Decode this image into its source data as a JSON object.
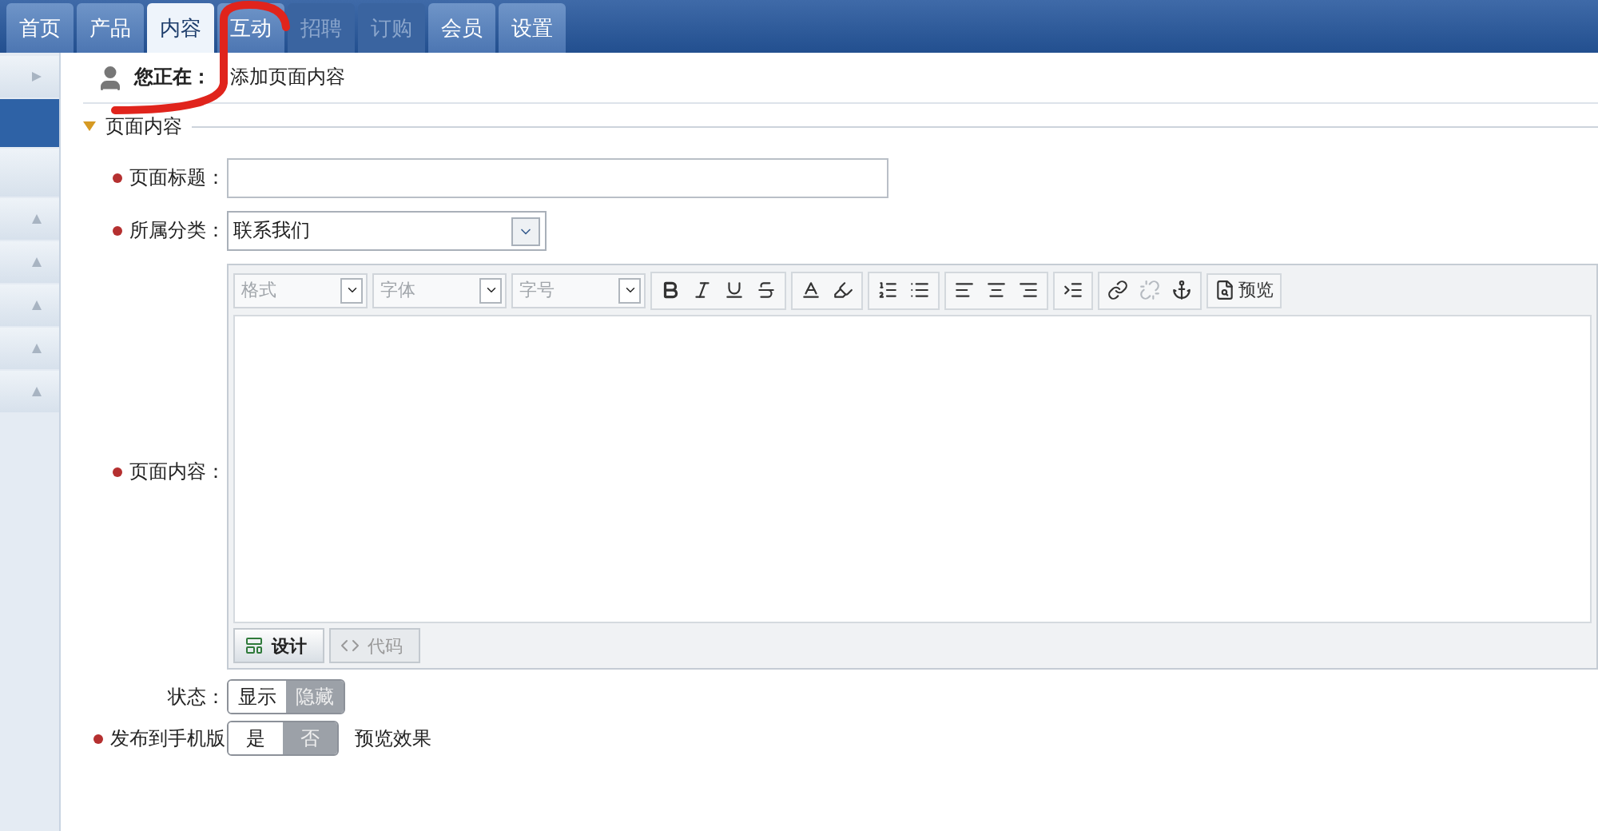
{
  "nav": {
    "tabs": [
      {
        "label": "首页",
        "selected": false,
        "disabled": false
      },
      {
        "label": "产品",
        "selected": false,
        "disabled": false
      },
      {
        "label": "内容",
        "selected": true,
        "disabled": false
      },
      {
        "label": "互动",
        "selected": false,
        "disabled": false
      },
      {
        "label": "招聘",
        "selected": false,
        "disabled": true
      },
      {
        "label": "订购",
        "selected": false,
        "disabled": true
      },
      {
        "label": "会员",
        "selected": false,
        "disabled": false
      },
      {
        "label": "设置",
        "selected": false,
        "disabled": false
      }
    ]
  },
  "sidebar": {
    "items": [
      {
        "kind": "expand",
        "selected": false
      },
      {
        "kind": "blank",
        "selected": true
      },
      {
        "kind": "blank",
        "selected": false
      },
      {
        "kind": "collapse",
        "selected": false
      },
      {
        "kind": "collapse",
        "selected": false
      },
      {
        "kind": "collapse",
        "selected": false
      },
      {
        "kind": "collapse",
        "selected": false
      },
      {
        "kind": "collapse",
        "selected": false
      }
    ]
  },
  "breadcrumb": {
    "label": "您正在：",
    "page": "添加页面内容"
  },
  "section": {
    "title": "页面内容",
    "expanded": true
  },
  "form": {
    "fields": [
      {
        "kind": "text",
        "label": "页面标题：",
        "required": true
      },
      {
        "kind": "select",
        "label": "所属分类：",
        "required": true,
        "value": "联系我们"
      },
      {
        "kind": "editor",
        "label": "页面内容：",
        "required": true
      }
    ]
  },
  "editor": {
    "combos": [
      {
        "placeholder": "格式"
      },
      {
        "placeholder": "字体"
      },
      {
        "placeholder": "字号"
      }
    ],
    "tool_groups": [
      {
        "tools": [
          {
            "kind": "bold",
            "disabled": false
          },
          {
            "kind": "italic",
            "disabled": false
          },
          {
            "kind": "underline",
            "disabled": false
          },
          {
            "kind": "strike",
            "disabled": false
          }
        ]
      },
      {
        "tools": [
          {
            "kind": "text-color",
            "disabled": false
          },
          {
            "kind": "highlight",
            "disabled": false
          }
        ]
      },
      {
        "tools": [
          {
            "kind": "ordered-list",
            "disabled": false
          },
          {
            "kind": "bullet-list",
            "disabled": false
          }
        ]
      },
      {
        "tools": [
          {
            "kind": "align-left",
            "disabled": false
          },
          {
            "kind": "align-center",
            "disabled": false
          },
          {
            "kind": "align-right",
            "disabled": false
          }
        ]
      },
      {
        "tools": [
          {
            "kind": "indent",
            "disabled": false
          }
        ]
      },
      {
        "tools": [
          {
            "kind": "link",
            "disabled": false
          },
          {
            "kind": "unlink",
            "disabled": true
          },
          {
            "kind": "anchor",
            "disabled": false
          }
        ]
      }
    ],
    "preview": "预览",
    "modes": [
      {
        "label": "设计",
        "selected": true
      },
      {
        "label": "代码",
        "selected": false
      }
    ]
  },
  "status": {
    "label": "状态：",
    "options": [
      {
        "label": "显示",
        "selected": true
      },
      {
        "label": "隐藏",
        "selected": false
      }
    ]
  },
  "mobile": {
    "label": "发布到手机版",
    "required": true,
    "options": [
      {
        "label": "是",
        "selected": true
      },
      {
        "label": "否",
        "selected": false
      }
    ],
    "link": "预览效果"
  }
}
